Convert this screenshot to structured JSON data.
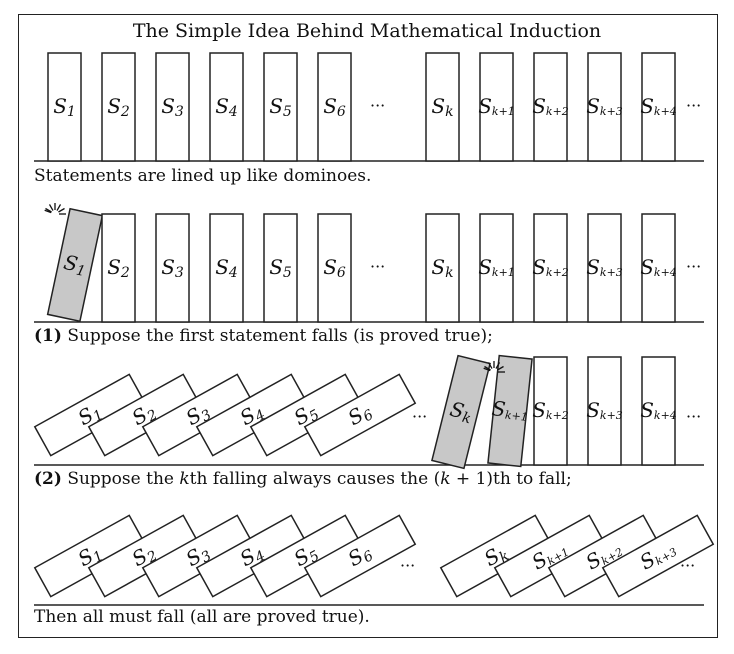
{
  "title": "The Simple Idea Behind Mathematical Induction",
  "ellipsis": "···",
  "dominoes": [
    {
      "letter": "S",
      "sub": "1"
    },
    {
      "letter": "S",
      "sub": "2"
    },
    {
      "letter": "S",
      "sub": "3"
    },
    {
      "letter": "S",
      "sub": "4"
    },
    {
      "letter": "S",
      "sub": "5"
    },
    {
      "letter": "S",
      "sub": "6"
    },
    {
      "letter": "S",
      "sub": "k"
    },
    {
      "letter": "S",
      "sub": "k+1"
    },
    {
      "letter": "S",
      "sub": "k+2"
    },
    {
      "letter": "S",
      "sub": "k+3"
    },
    {
      "letter": "S",
      "sub": "k+4"
    }
  ],
  "captions": {
    "row1": "Statements are lined up like dominoes.",
    "row2_num": "(1)",
    "row2_text": " Suppose the first statement falls (is proved true);",
    "row3_num": "(2)",
    "row3_text_a": " Suppose the ",
    "row3_k": "k",
    "row3_text_b": "th falling always causes the (",
    "row3_k2": "k",
    "row3_text_c": " + 1)th to fall;",
    "row4": "Then all must fall (all are proved true)."
  },
  "colors": {
    "fallen_fill": "#c8c8c8",
    "standing_fill": "#ffffff",
    "stroke": "#222222"
  }
}
